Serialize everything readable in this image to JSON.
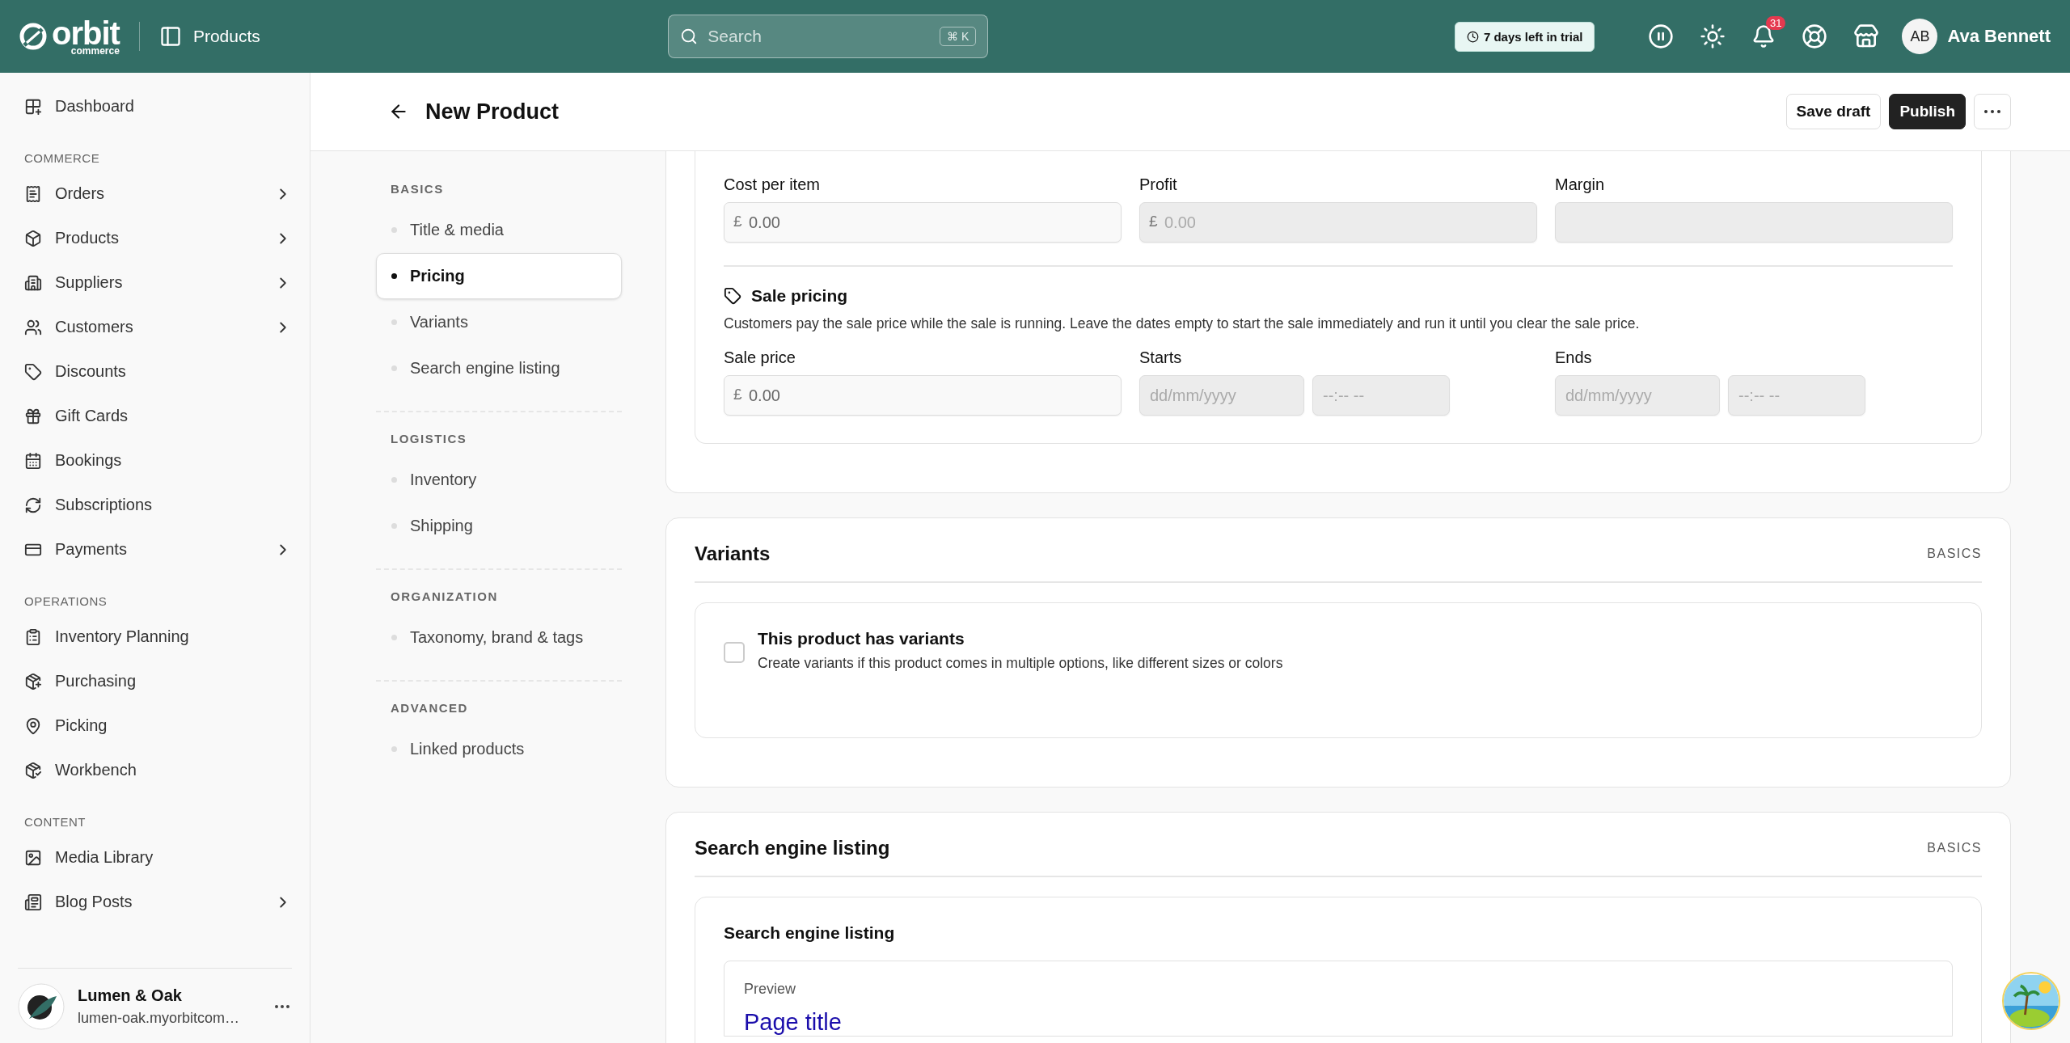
{
  "topbar": {
    "logo": {
      "name": "orbit",
      "tagline": "commerce"
    },
    "section": "Products",
    "search": {
      "placeholder": "Search",
      "shortcut": "⌘ K"
    },
    "trial_badge": "7 days left in trial",
    "notifications": "31",
    "user": {
      "initials": "AB",
      "name": "Ava Bennett"
    }
  },
  "sidebar": {
    "groups": [
      {
        "items": [
          {
            "label": "Dashboard",
            "expandable": false
          }
        ]
      },
      {
        "heading": "COMMERCE",
        "items": [
          {
            "label": "Orders",
            "expandable": true
          },
          {
            "label": "Products",
            "expandable": true
          },
          {
            "label": "Suppliers",
            "expandable": true
          },
          {
            "label": "Customers",
            "expandable": true
          },
          {
            "label": "Discounts",
            "expandable": false
          },
          {
            "label": "Gift Cards",
            "expandable": false
          },
          {
            "label": "Bookings",
            "expandable": false
          },
          {
            "label": "Subscriptions",
            "expandable": false
          },
          {
            "label": "Payments",
            "expandable": true
          }
        ]
      },
      {
        "heading": "OPERATIONS",
        "items": [
          {
            "label": "Inventory Planning",
            "expandable": false
          },
          {
            "label": "Purchasing",
            "expandable": false
          },
          {
            "label": "Picking",
            "expandable": false
          },
          {
            "label": "Workbench",
            "expandable": false
          }
        ]
      },
      {
        "heading": "CONTENT",
        "items": [
          {
            "label": "Media Library",
            "expandable": false
          },
          {
            "label": "Blog Posts",
            "expandable": true
          }
        ]
      }
    ],
    "store": {
      "name": "Lumen & Oak",
      "domain": "lumen-oak.myorbitcom…"
    }
  },
  "page": {
    "title": "New Product",
    "buttons": [
      {
        "label": "Save draft",
        "kind": "secondary"
      },
      {
        "label": "Publish",
        "kind": "primary"
      }
    ]
  },
  "section_nav": [
    {
      "heading": "BASICS",
      "items": [
        {
          "label": "Title & media",
          "selected": false
        },
        {
          "label": "Pricing",
          "selected": true
        },
        {
          "label": "Variants",
          "selected": false
        },
        {
          "label": "Search engine listing",
          "selected": false
        }
      ]
    },
    {
      "heading": "LOGISTICS",
      "items": [
        {
          "label": "Inventory",
          "selected": false
        },
        {
          "label": "Shipping",
          "selected": false
        }
      ]
    },
    {
      "heading": "ORGANIZATION",
      "items": [
        {
          "label": "Taxonomy, brand & tags",
          "selected": false
        }
      ]
    },
    {
      "heading": "ADVANCED",
      "items": [
        {
          "label": "Linked products",
          "selected": false
        }
      ]
    }
  ],
  "pricing": {
    "cost_fields": [
      {
        "label": "Cost per item",
        "prefix": "£",
        "placeholder": "0.00",
        "disabled": false
      },
      {
        "label": "Profit",
        "prefix": "£",
        "placeholder": "0.00",
        "disabled": true
      },
      {
        "label": "Margin",
        "disabled": true
      }
    ],
    "sale": {
      "title": "Sale pricing",
      "description": "Customers pay the sale price while the sale is running. Leave the dates empty to start the sale immediately and run it until you clear the sale price.",
      "sale_price": {
        "label": "Sale price",
        "prefix": "£",
        "placeholder": "0.00"
      },
      "ranges": [
        {
          "label": "Starts",
          "date_placeholder": "dd/mm/yyyy",
          "time_placeholder": "--:-- --"
        },
        {
          "label": "Ends",
          "date_placeholder": "dd/mm/yyyy",
          "time_placeholder": "--:-- --"
        }
      ]
    }
  },
  "variants": {
    "title": "Variants",
    "tag": "BASICS",
    "option": {
      "label": "This product has variants",
      "description": "Create variants if this product comes in multiple options, like different sizes or colors",
      "checked": false
    }
  },
  "seo": {
    "title": "Search engine listing",
    "tag": "BASICS",
    "subtitle": "Search engine listing",
    "preview_label": "Preview",
    "preview_title": "Page title"
  }
}
